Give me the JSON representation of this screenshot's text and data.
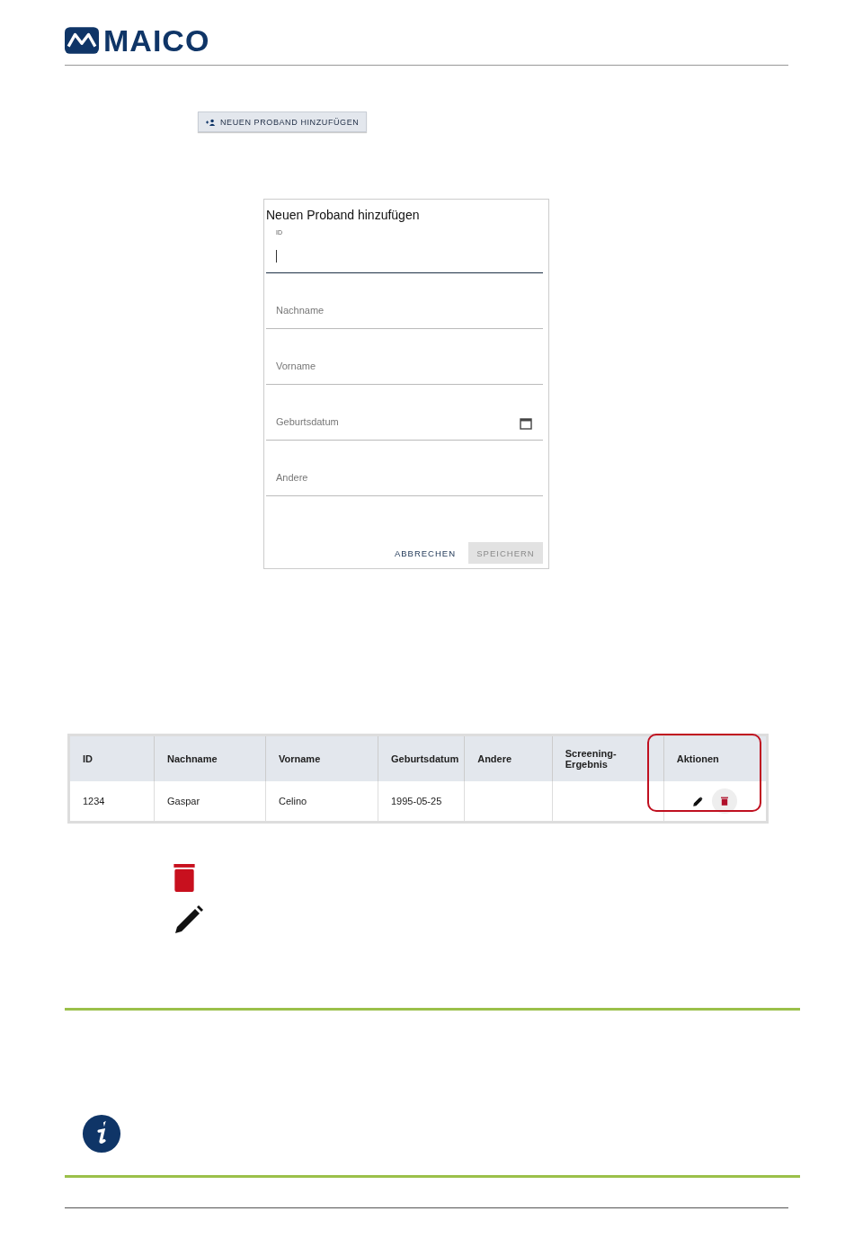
{
  "logo": {
    "text": "MAICO"
  },
  "add_button": {
    "label": "NEUEN PROBAND HINZUFÜGEN"
  },
  "dialog": {
    "title": "Neuen Proband hinzufügen",
    "fields": [
      {
        "kind": "text",
        "label": "ID",
        "focused": true
      },
      {
        "kind": "text",
        "placeholder": "Nachname",
        "focused": false
      },
      {
        "kind": "text",
        "placeholder": "Vorname",
        "focused": false
      },
      {
        "kind": "date",
        "placeholder": "Geburtsdatum",
        "focused": false
      },
      {
        "kind": "text",
        "placeholder": "Andere",
        "focused": false
      }
    ],
    "buttons": [
      {
        "label": "ABBRECHEN",
        "disabled": false
      },
      {
        "label": "SPEICHERN",
        "disabled": true
      }
    ]
  },
  "table": {
    "columns": [
      "ID",
      "Nachname",
      "Vorname",
      "Geburtsdatum",
      "Andere",
      "Screening-Ergebnis",
      "Aktionen"
    ],
    "rows": [
      {
        "id": "1234",
        "nachname": "Gaspar",
        "vorname": "Celino",
        "geburtsdatum": "1995-05-25"
      }
    ]
  }
}
